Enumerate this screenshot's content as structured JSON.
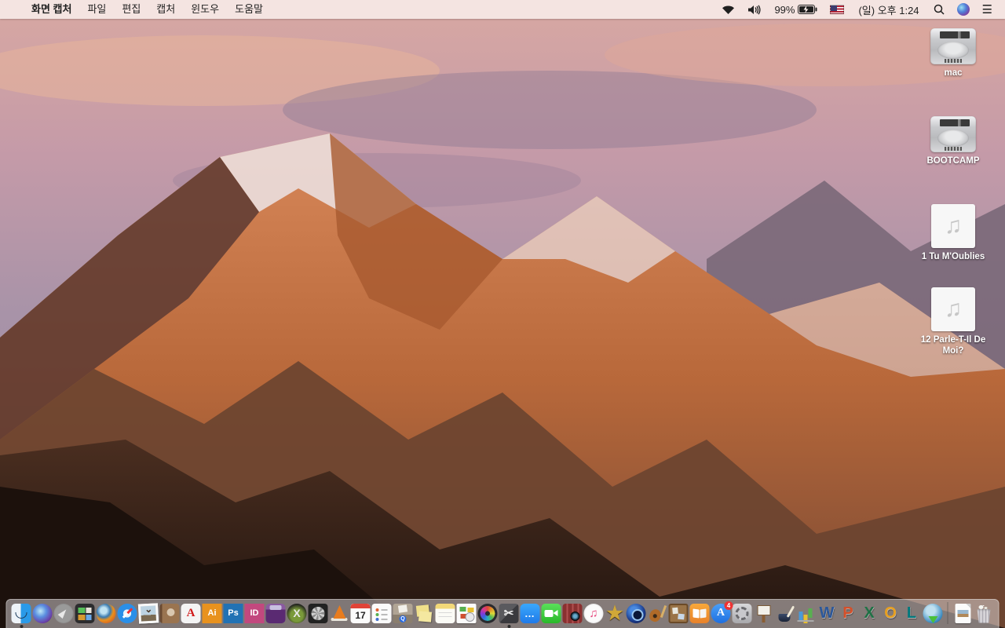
{
  "menu_bar": {
    "app_name": "화면 캡처",
    "menus": [
      "파일",
      "편집",
      "캡처",
      "윈도우",
      "도움말"
    ],
    "status": {
      "battery_percent": "99%",
      "clock": "(일) 오후 1:24",
      "icons": [
        "wifi-icon",
        "volume-icon",
        "battery-charging-icon",
        "us-flag-icon",
        "spotlight-search-icon",
        "siri-icon",
        "notification-center-icon"
      ]
    }
  },
  "desktop": {
    "icons": [
      {
        "name": "drive-mac",
        "label": "mac",
        "type": "hdd"
      },
      {
        "name": "drive-bootcamp",
        "label": "BOOTCAMP",
        "type": "hdd"
      },
      {
        "name": "audio-file-1",
        "label": "1 Tu M'Oublies",
        "type": "audio",
        "glyph": "♫"
      },
      {
        "name": "audio-file-2",
        "label": "12 Parle-T-Il De Moi?",
        "type": "audio",
        "glyph": "♫"
      }
    ]
  },
  "dock": {
    "items": [
      {
        "name": "finder",
        "running": true
      },
      {
        "name": "siri"
      },
      {
        "name": "launchpad"
      },
      {
        "name": "mission-control"
      },
      {
        "name": "firefox"
      },
      {
        "name": "safari"
      },
      {
        "name": "bird-photo"
      },
      {
        "name": "contacts"
      },
      {
        "name": "acrobat",
        "text": "A"
      },
      {
        "name": "illustrator",
        "text": "Ai"
      },
      {
        "name": "photoshop",
        "text": "Ps"
      },
      {
        "name": "indesign",
        "text": "ID"
      },
      {
        "name": "toast"
      },
      {
        "name": "x-app",
        "text": "X"
      },
      {
        "name": "disk-fan"
      },
      {
        "name": "vlc"
      },
      {
        "name": "calendar",
        "text": "17"
      },
      {
        "name": "reminders"
      },
      {
        "name": "archive-box"
      },
      {
        "name": "stickies"
      },
      {
        "name": "notes"
      },
      {
        "name": "report-doc"
      },
      {
        "name": "photos"
      },
      {
        "name": "grab",
        "text": "✂",
        "running": true
      },
      {
        "name": "messages",
        "text": "…"
      },
      {
        "name": "facetime"
      },
      {
        "name": "photo-booth"
      },
      {
        "name": "itunes",
        "text": "♫"
      },
      {
        "name": "imovie-star",
        "text": "★"
      },
      {
        "name": "blue-camera"
      },
      {
        "name": "garageband"
      },
      {
        "name": "bulletin-board"
      },
      {
        "name": "ibooks"
      },
      {
        "name": "app-store",
        "text": "A",
        "badge": "4"
      },
      {
        "name": "sys-prefs"
      },
      {
        "name": "keynote-old"
      },
      {
        "name": "pages-old"
      },
      {
        "name": "numbers-old"
      },
      {
        "name": "word",
        "text": "W",
        "office": true,
        "color": "#2b579a"
      },
      {
        "name": "powerpoint",
        "text": "P",
        "office": true,
        "color": "#d4502a"
      },
      {
        "name": "excel",
        "text": "X",
        "office": true,
        "color": "#1e7145"
      },
      {
        "name": "outlook",
        "text": "O",
        "office": true,
        "color": "#e8a020"
      },
      {
        "name": "lync",
        "text": "L",
        "office": true,
        "color": "#00797d"
      },
      {
        "name": "downloader"
      },
      {
        "name": "divider",
        "divider": true
      },
      {
        "name": "document-file"
      },
      {
        "name": "trash"
      }
    ]
  },
  "wallpaper": {
    "name": "macos-sierra-mountain",
    "sky_top": "#d8a8a2",
    "sky_mid": "#a893a8",
    "peak_lit": "#c87c44",
    "peak_shadow": "#5c3a32",
    "foreground": "#2e1c14"
  }
}
